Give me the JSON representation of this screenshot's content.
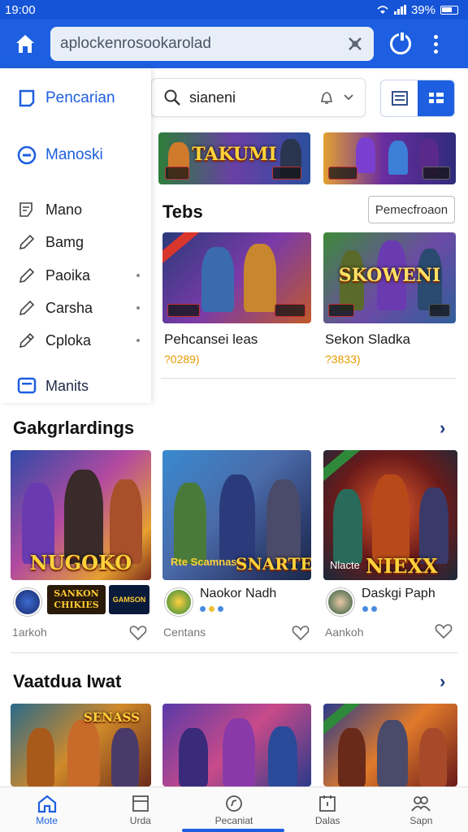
{
  "status": {
    "time": "19:00",
    "battery": "39%"
  },
  "topbar": {
    "url": "aplockenrosookarolad"
  },
  "sidebar": {
    "items": [
      {
        "label": "Pencarian"
      },
      {
        "label": "Manoski"
      },
      {
        "label": "Mano"
      },
      {
        "label": "Bamg"
      },
      {
        "label": "Paoika"
      },
      {
        "label": "Carsha"
      },
      {
        "label": "Cploka"
      },
      {
        "label": "Manits"
      }
    ]
  },
  "search": {
    "value": "sianeni"
  },
  "featured": [
    {
      "art_title": "TAKUMI"
    },
    {
      "art_title": ""
    }
  ],
  "tebs": {
    "title": "Tebs",
    "filter_label": "Pemecfroaon",
    "cards": [
      {
        "name": "Pehcansei leas",
        "sub": "?0289)"
      },
      {
        "name": "Sekon Sladka",
        "sub": "?3833)",
        "art_title": "SKOWENI"
      }
    ]
  },
  "section2": {
    "title": "Gakgrlardings",
    "cards": [
      {
        "art_title": "NUGOKO",
        "name": "",
        "meta": "1arkoh"
      },
      {
        "art_title": "SNARTE",
        "art_tag": "Rte Scamnas",
        "name": "Naokor Nadh",
        "meta": "Centans"
      },
      {
        "art_title": "NIEXX",
        "art_tag": "Nlacte",
        "name": "Daskgi Paph",
        "meta": "Aankoh"
      }
    ],
    "banner_left": "SANKON\nCHIKIES",
    "banner_right": "GAMSON"
  },
  "section3": {
    "title": "Vaatdua Iwat",
    "cards": [
      {
        "art_title": "SENASS"
      },
      {
        "art_title": ""
      },
      {
        "art_title": ""
      }
    ]
  },
  "bottomnav": [
    {
      "label": "Mote",
      "icon": "home-icon"
    },
    {
      "label": "Urda",
      "icon": "window-icon"
    },
    {
      "label": "Pecaniat",
      "icon": "compass-icon"
    },
    {
      "label": "Dalas",
      "icon": "calendar-icon"
    },
    {
      "label": "Sapn",
      "icon": "people-icon"
    }
  ],
  "colors": {
    "brand": "#1d5fe0",
    "accent": "#e59b00"
  }
}
